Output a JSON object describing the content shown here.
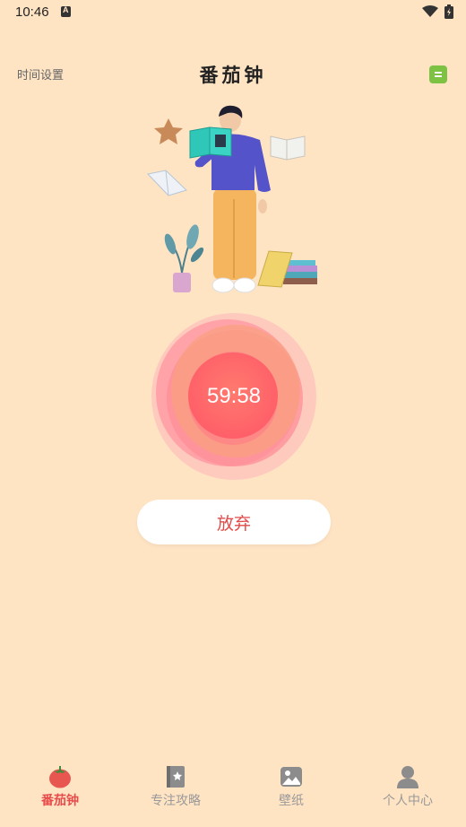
{
  "status_bar": {
    "time": "10:46"
  },
  "header": {
    "time_setting": "时间设置",
    "title": "番茄钟"
  },
  "timer": {
    "display": "59:58"
  },
  "actions": {
    "give_up": "放弃"
  },
  "bottom_nav": {
    "items": [
      {
        "label": "番茄钟",
        "icon": "tomato-icon",
        "active": true
      },
      {
        "label": "专注攻略",
        "icon": "book-icon",
        "active": false
      },
      {
        "label": "壁纸",
        "icon": "image-icon",
        "active": false
      },
      {
        "label": "个人中心",
        "icon": "person-icon",
        "active": false
      }
    ]
  },
  "colors": {
    "background": "#FFE4C4",
    "accent": "#E74C4C",
    "note_icon": "#7DC243"
  }
}
